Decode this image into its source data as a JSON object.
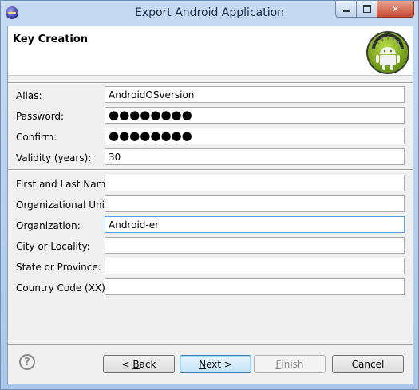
{
  "window": {
    "title": "Export Android Application"
  },
  "header": {
    "title": "Key Creation"
  },
  "fields": [
    {
      "label": "Alias:",
      "value": "AndroidOSversion",
      "type": "text"
    },
    {
      "label": "Password:",
      "value": "●●●●●●●●",
      "type": "password"
    },
    {
      "label": "Confirm:",
      "value": "●●●●●●●●",
      "type": "password"
    },
    {
      "label": "Validity (years):",
      "value": "30",
      "type": "text"
    },
    {
      "label": "First and Last Name:",
      "value": "",
      "type": "text"
    },
    {
      "label": "Organizational Unit:",
      "value": "",
      "type": "text"
    },
    {
      "label": "Organization:",
      "value": "Android-er",
      "type": "text"
    },
    {
      "label": "City or Locality:",
      "value": "",
      "type": "text"
    },
    {
      "label": "State or Province:",
      "value": "",
      "type": "text"
    },
    {
      "label": "Country Code (XX):",
      "value": "",
      "type": "text"
    }
  ],
  "buttons": {
    "back_prefix": "< ",
    "back_mnemonic": "B",
    "back_rest": "ack",
    "next_mnemonic": "N",
    "next_rest": "ext >",
    "finish_mnemonic": "F",
    "finish_rest": "inish",
    "cancel": "Cancel",
    "help": "?"
  },
  "colors": {
    "title_bar": "#a9c6e8",
    "close_button": "#c74a2c",
    "focus_border": "#569de5",
    "android_green": "#97c024"
  },
  "icons": {
    "app": "eclipse-icon",
    "logo": "android-logo-icon",
    "help": "help-icon"
  }
}
